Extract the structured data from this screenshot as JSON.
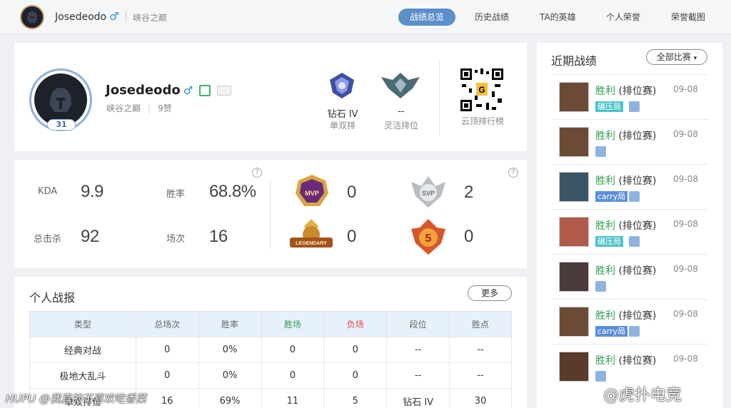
{
  "header": {
    "username": "Josedeodo",
    "gender_symbol": "♂",
    "server": "峡谷之巅",
    "nav": [
      "战绩总览",
      "历史战绩",
      "TA的英雄",
      "个人荣誉",
      "荣誉截图"
    ]
  },
  "profile": {
    "name": "Josedeodo",
    "gender_symbol": "♂",
    "server": "峡谷之巅",
    "likes": "9赞",
    "level": "31",
    "solo_rank": "钻石 IV",
    "solo_label": "单双排",
    "flex_rank": "--",
    "flex_label": "灵活排位",
    "qr_label": "云顶排行榜"
  },
  "stats": {
    "kda_label": "KDA",
    "kda": "9.9",
    "winrate_label": "胜率",
    "winrate": "68.8%",
    "kills_label": "总击杀",
    "kills": "92",
    "games_label": "场次",
    "games": "16",
    "help": "?"
  },
  "honors": {
    "mvp": "0",
    "svp": "2",
    "legendary": "0",
    "pentakill": "0",
    "mvp_badge": "MVP",
    "svp_badge": "SVP",
    "legendary_badge": "LEGENDARY",
    "penta_badge": "5"
  },
  "report": {
    "title": "个人战报",
    "more": "更多",
    "headers": [
      "类型",
      "总场次",
      "胜率",
      "胜场",
      "负场",
      "段位",
      "胜点"
    ],
    "rows": [
      [
        "经典对战",
        "0",
        "0%",
        "0",
        "0",
        "--",
        "--"
      ],
      [
        "极地大乱斗",
        "0",
        "0%",
        "0",
        "0",
        "--",
        "--"
      ],
      [
        "单双排位",
        "16",
        "69%",
        "11",
        "5",
        "钻石 IV",
        "30"
      ]
    ]
  },
  "recent": {
    "title": "近期战绩",
    "filter": "全部比赛",
    "items": [
      {
        "result": "胜利",
        "mode": "(排位赛)",
        "date": "09-08",
        "tag": "碾压局",
        "tag_type": "crush"
      },
      {
        "result": "胜利",
        "mode": "(排位赛)",
        "date": "09-08",
        "tag": "",
        "tag_type": ""
      },
      {
        "result": "胜利",
        "mode": "(排位赛)",
        "date": "09-08",
        "tag": "carry局",
        "tag_type": "carry"
      },
      {
        "result": "胜利",
        "mode": "(排位赛)",
        "date": "09-08",
        "tag": "碾压局",
        "tag_type": "crush"
      },
      {
        "result": "胜利",
        "mode": "(排位赛)",
        "date": "09-08",
        "tag": "",
        "tag_type": ""
      },
      {
        "result": "胜利",
        "mode": "(排位赛)",
        "date": "09-08",
        "tag": "carry局",
        "tag_type": "carry"
      },
      {
        "result": "胜利",
        "mode": "(排位赛)",
        "date": "09-08",
        "tag": "",
        "tag_type": ""
      }
    ]
  },
  "watermarks": {
    "left": "HUPU @我真的不喜欢吃香菜",
    "right": "@虎扑电竞"
  },
  "colors": {
    "accent": "#5b8fc9",
    "win": "#2e9e4f",
    "lose": "#e04b4b"
  }
}
